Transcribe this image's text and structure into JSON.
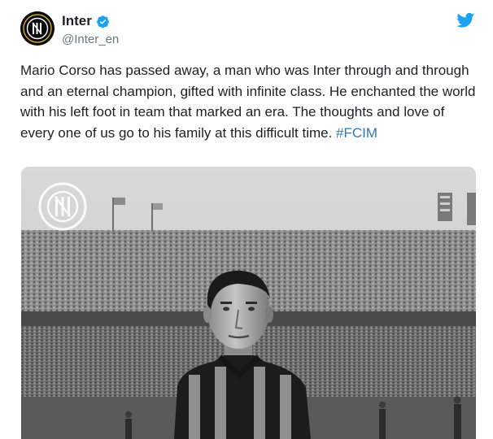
{
  "author": {
    "display_name": "Inter",
    "handle": "@Inter_en",
    "verified": true,
    "avatar_icon": "inter-crest-icon"
  },
  "platform_icon": "twitter-bird-icon",
  "tweet": {
    "text": "Mario Corso has passed away, a man who was Inter through and through and an eternal champion, gifted with infinite class. He enchanted the world with his left foot in team that marked an era. The thoughts and love of every one of us go to his family at this difficult time.",
    "hashtag": "#FCIM"
  },
  "media": {
    "type": "photo",
    "watermark_icon": "inter-crest-watermark-icon"
  },
  "colors": {
    "link": "#2b7bb9",
    "twitter_blue": "#1da1f2",
    "secondary_text": "#697882"
  }
}
